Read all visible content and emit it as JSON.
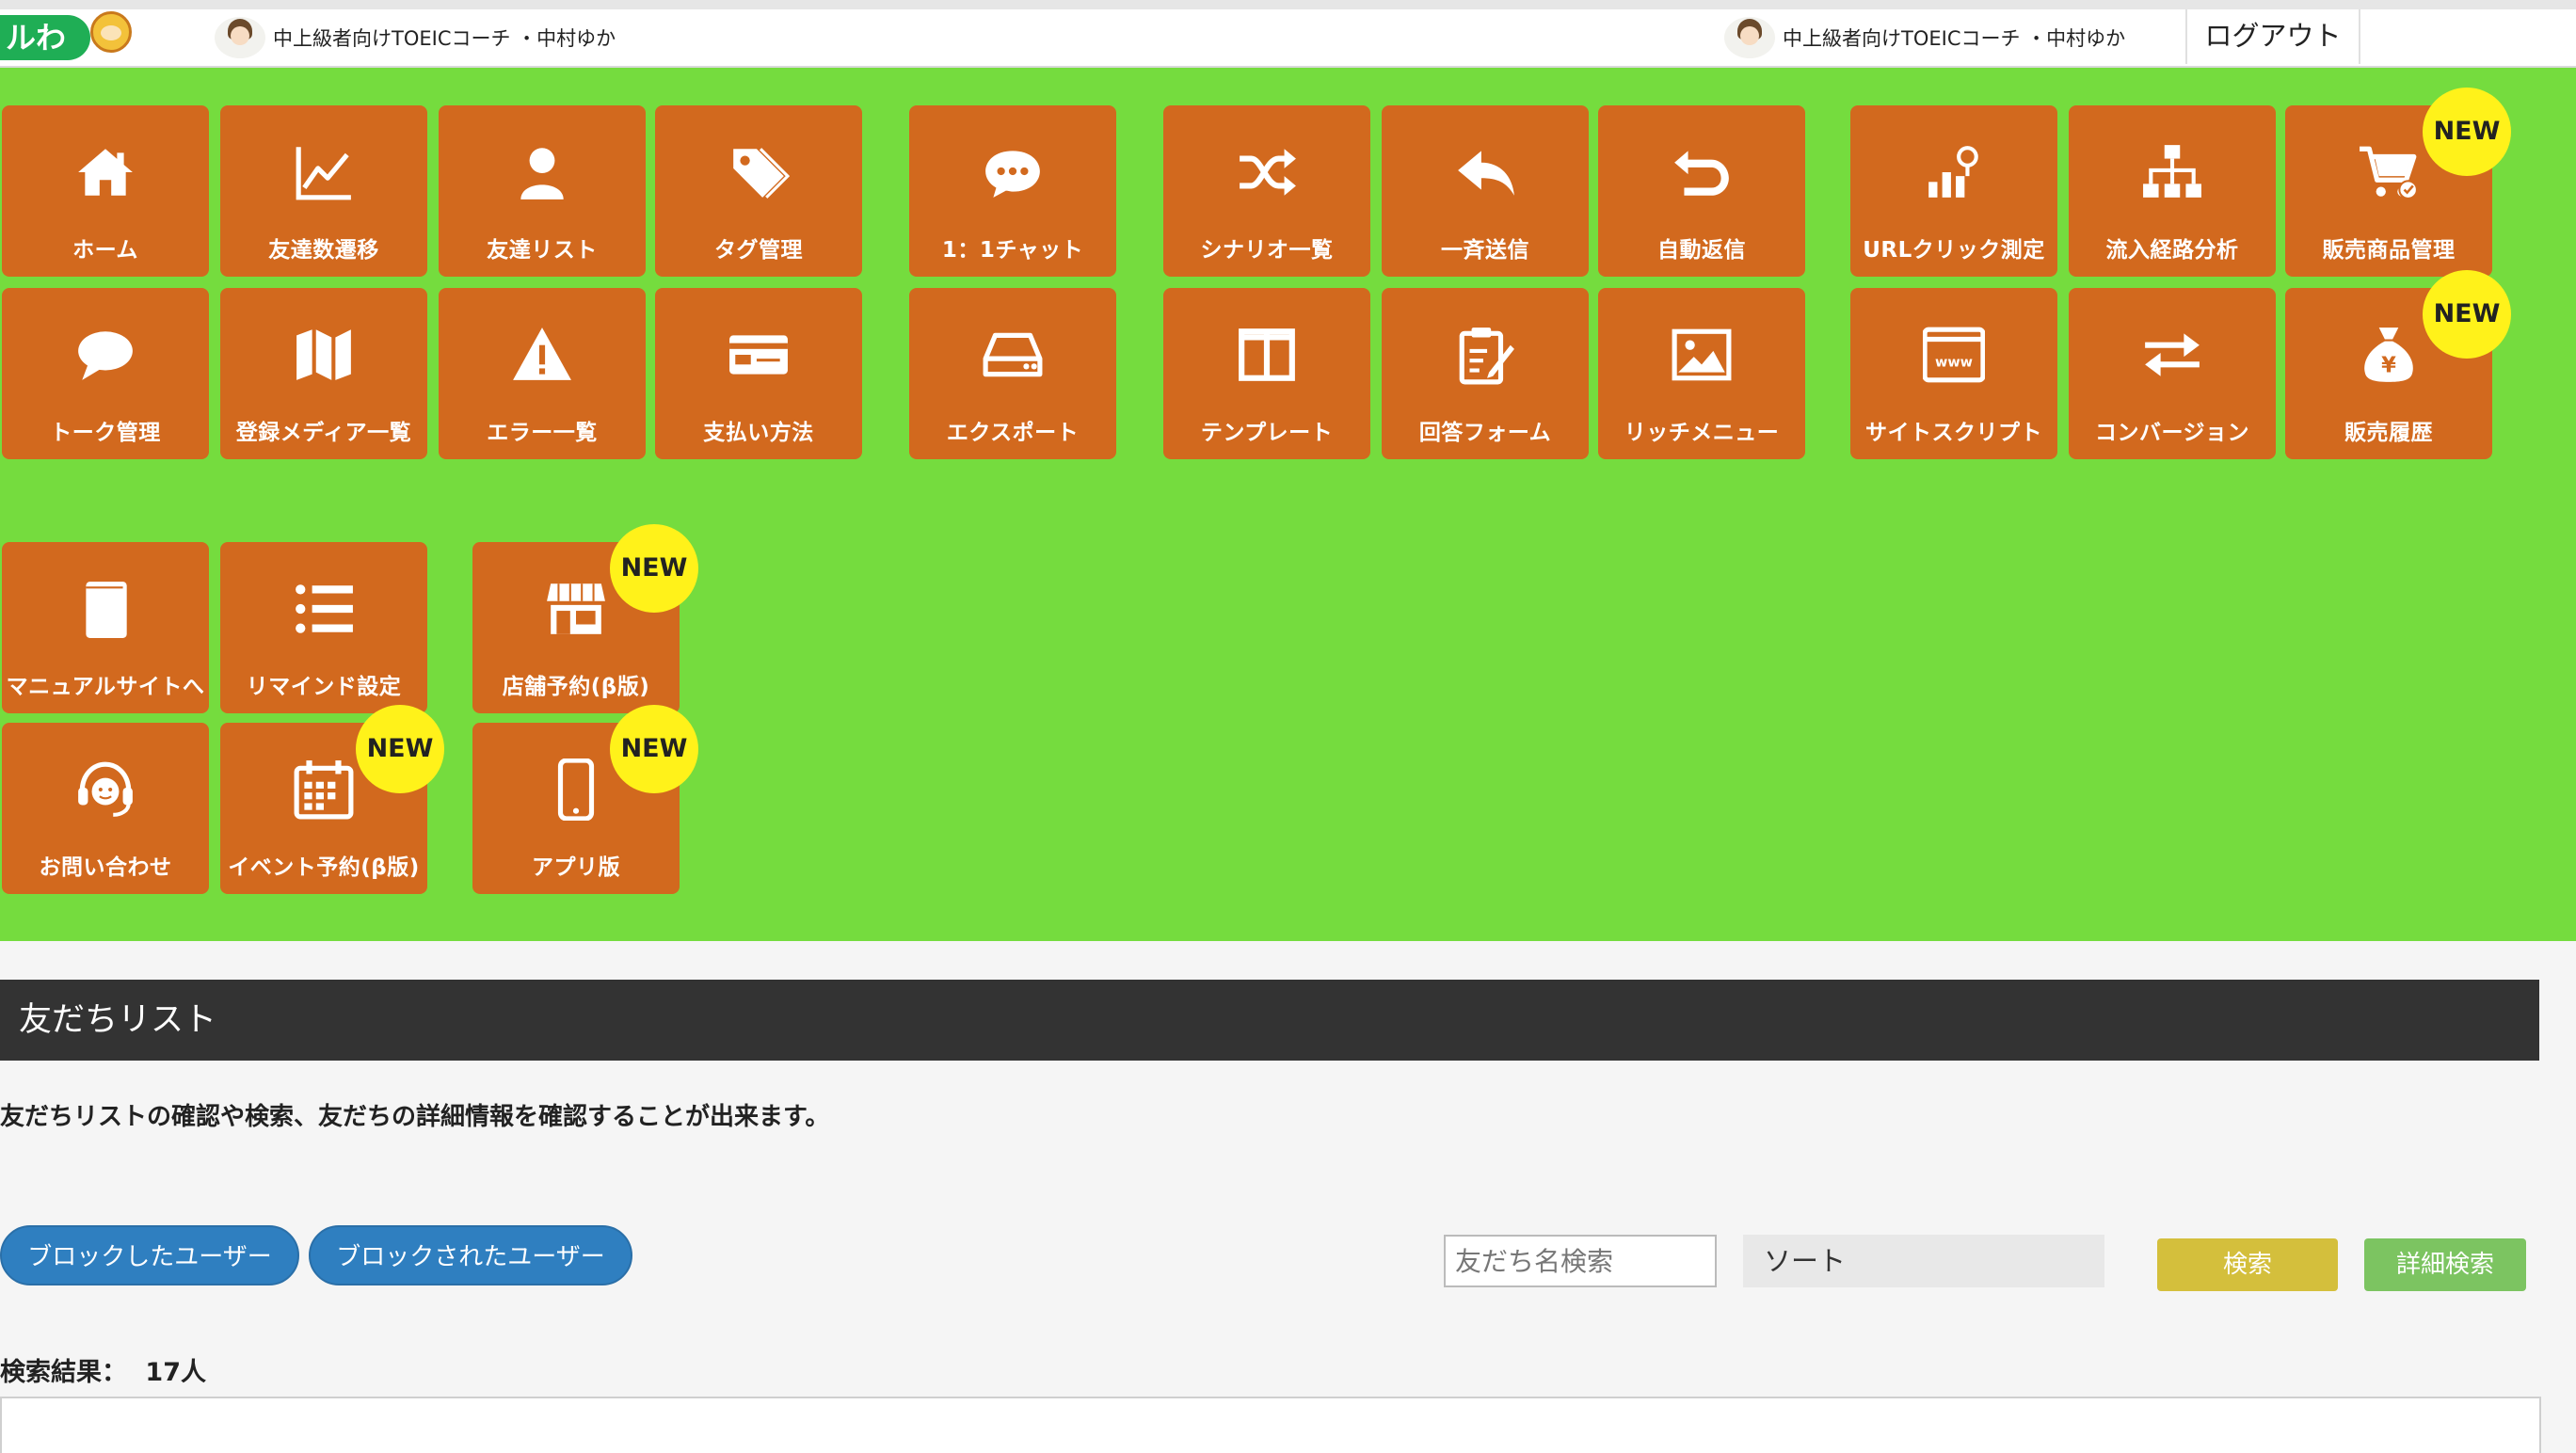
{
  "header": {
    "logo_text": "ルわか",
    "account_name": "中上級者向けTOEICコーチ ・中村ゆか",
    "logout_label": "ログアウト"
  },
  "menu": {
    "new_badge": "NEW",
    "tiles": [
      {
        "label": "ホーム",
        "icon": "home-icon"
      },
      {
        "label": "友達数遷移",
        "icon": "line-chart-icon"
      },
      {
        "label": "友達リスト",
        "icon": "user-icon"
      },
      {
        "label": "タグ管理",
        "icon": "tag-icon"
      },
      {
        "label": "1：1チャット",
        "icon": "chat-bubble-icon"
      },
      {
        "label": "シナリオ一覧",
        "icon": "shuffle-icon"
      },
      {
        "label": "一斉送信",
        "icon": "reply-icon"
      },
      {
        "label": "自動返信",
        "icon": "return-icon"
      },
      {
        "label": "URLクリック測定",
        "icon": "click-measure-icon"
      },
      {
        "label": "流入経路分析",
        "icon": "sitemap-icon"
      },
      {
        "label": "販売商品管理",
        "icon": "cart-icon"
      },
      {
        "label": "トーク管理",
        "icon": "speech-bubble-icon"
      },
      {
        "label": "登録メディア一覧",
        "icon": "map-icon"
      },
      {
        "label": "エラー一覧",
        "icon": "warning-icon"
      },
      {
        "label": "支払い方法",
        "icon": "credit-card-icon"
      },
      {
        "label": "エクスポート",
        "icon": "drive-icon"
      },
      {
        "label": "テンプレート",
        "icon": "columns-icon"
      },
      {
        "label": "回答フォーム",
        "icon": "form-icon"
      },
      {
        "label": "リッチメニュー",
        "icon": "image-icon"
      },
      {
        "label": "サイトスクリプト",
        "icon": "www-icon"
      },
      {
        "label": "コンバージョン",
        "icon": "exchange-icon"
      },
      {
        "label": "販売履歴",
        "icon": "money-bag-icon"
      },
      {
        "label": "マニュアルサイトへ",
        "icon": "book-icon"
      },
      {
        "label": "リマインド設定",
        "icon": "list-icon"
      },
      {
        "label": "店舗予約(β版)",
        "icon": "store-icon"
      },
      {
        "label": "お問い合わせ",
        "icon": "headset-icon"
      },
      {
        "label": "イベント予約(β版)",
        "icon": "calendar-icon"
      },
      {
        "label": "アプリ版",
        "icon": "mobile-icon"
      }
    ]
  },
  "main": {
    "section_title": "友だちリスト",
    "description": "友だちリストの確認や検索、友だちの詳細情報を確認することが出来ます。",
    "blocked_users_label": "ブロックしたユーザー",
    "blocked_by_users_label": "ブロックされたユーザー",
    "search_placeholder": "友だち名検索",
    "sort_label": "ソート",
    "search_button": "検索",
    "advanced_search_button": "詳細検索",
    "result_label": "検索結果：",
    "result_count": "17人"
  },
  "colors": {
    "menu_background": "#75dc3e",
    "tile": "#d2691e",
    "badge": "#fff21a",
    "pill_button": "#2f7fc0",
    "search_button": "#d4bf3c",
    "advanced_search_button": "#7cc461",
    "section_title_bar": "#333333"
  }
}
